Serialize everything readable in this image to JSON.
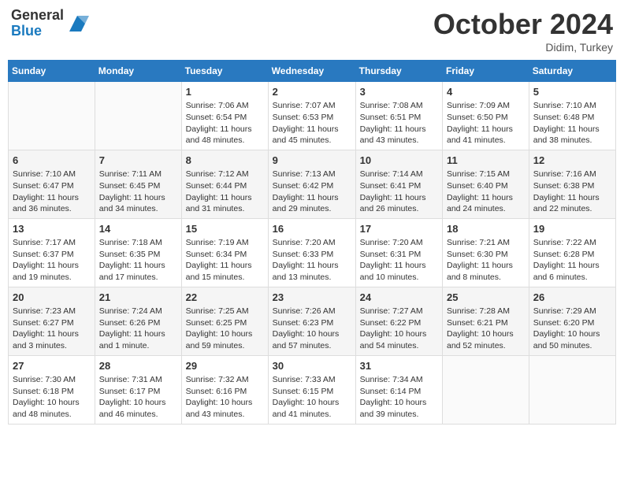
{
  "header": {
    "logo_general": "General",
    "logo_blue": "Blue",
    "month_title": "October 2024",
    "location": "Didim, Turkey"
  },
  "days_of_week": [
    "Sunday",
    "Monday",
    "Tuesday",
    "Wednesday",
    "Thursday",
    "Friday",
    "Saturday"
  ],
  "weeks": [
    [
      {
        "day": "",
        "sunrise": "",
        "sunset": "",
        "daylight": ""
      },
      {
        "day": "",
        "sunrise": "",
        "sunset": "",
        "daylight": ""
      },
      {
        "day": "1",
        "sunrise": "Sunrise: 7:06 AM",
        "sunset": "Sunset: 6:54 PM",
        "daylight": "Daylight: 11 hours and 48 minutes."
      },
      {
        "day": "2",
        "sunrise": "Sunrise: 7:07 AM",
        "sunset": "Sunset: 6:53 PM",
        "daylight": "Daylight: 11 hours and 45 minutes."
      },
      {
        "day": "3",
        "sunrise": "Sunrise: 7:08 AM",
        "sunset": "Sunset: 6:51 PM",
        "daylight": "Daylight: 11 hours and 43 minutes."
      },
      {
        "day": "4",
        "sunrise": "Sunrise: 7:09 AM",
        "sunset": "Sunset: 6:50 PM",
        "daylight": "Daylight: 11 hours and 41 minutes."
      },
      {
        "day": "5",
        "sunrise": "Sunrise: 7:10 AM",
        "sunset": "Sunset: 6:48 PM",
        "daylight": "Daylight: 11 hours and 38 minutes."
      }
    ],
    [
      {
        "day": "6",
        "sunrise": "Sunrise: 7:10 AM",
        "sunset": "Sunset: 6:47 PM",
        "daylight": "Daylight: 11 hours and 36 minutes."
      },
      {
        "day": "7",
        "sunrise": "Sunrise: 7:11 AM",
        "sunset": "Sunset: 6:45 PM",
        "daylight": "Daylight: 11 hours and 34 minutes."
      },
      {
        "day": "8",
        "sunrise": "Sunrise: 7:12 AM",
        "sunset": "Sunset: 6:44 PM",
        "daylight": "Daylight: 11 hours and 31 minutes."
      },
      {
        "day": "9",
        "sunrise": "Sunrise: 7:13 AM",
        "sunset": "Sunset: 6:42 PM",
        "daylight": "Daylight: 11 hours and 29 minutes."
      },
      {
        "day": "10",
        "sunrise": "Sunrise: 7:14 AM",
        "sunset": "Sunset: 6:41 PM",
        "daylight": "Daylight: 11 hours and 26 minutes."
      },
      {
        "day": "11",
        "sunrise": "Sunrise: 7:15 AM",
        "sunset": "Sunset: 6:40 PM",
        "daylight": "Daylight: 11 hours and 24 minutes."
      },
      {
        "day": "12",
        "sunrise": "Sunrise: 7:16 AM",
        "sunset": "Sunset: 6:38 PM",
        "daylight": "Daylight: 11 hours and 22 minutes."
      }
    ],
    [
      {
        "day": "13",
        "sunrise": "Sunrise: 7:17 AM",
        "sunset": "Sunset: 6:37 PM",
        "daylight": "Daylight: 11 hours and 19 minutes."
      },
      {
        "day": "14",
        "sunrise": "Sunrise: 7:18 AM",
        "sunset": "Sunset: 6:35 PM",
        "daylight": "Daylight: 11 hours and 17 minutes."
      },
      {
        "day": "15",
        "sunrise": "Sunrise: 7:19 AM",
        "sunset": "Sunset: 6:34 PM",
        "daylight": "Daylight: 11 hours and 15 minutes."
      },
      {
        "day": "16",
        "sunrise": "Sunrise: 7:20 AM",
        "sunset": "Sunset: 6:33 PM",
        "daylight": "Daylight: 11 hours and 13 minutes."
      },
      {
        "day": "17",
        "sunrise": "Sunrise: 7:20 AM",
        "sunset": "Sunset: 6:31 PM",
        "daylight": "Daylight: 11 hours and 10 minutes."
      },
      {
        "day": "18",
        "sunrise": "Sunrise: 7:21 AM",
        "sunset": "Sunset: 6:30 PM",
        "daylight": "Daylight: 11 hours and 8 minutes."
      },
      {
        "day": "19",
        "sunrise": "Sunrise: 7:22 AM",
        "sunset": "Sunset: 6:28 PM",
        "daylight": "Daylight: 11 hours and 6 minutes."
      }
    ],
    [
      {
        "day": "20",
        "sunrise": "Sunrise: 7:23 AM",
        "sunset": "Sunset: 6:27 PM",
        "daylight": "Daylight: 11 hours and 3 minutes."
      },
      {
        "day": "21",
        "sunrise": "Sunrise: 7:24 AM",
        "sunset": "Sunset: 6:26 PM",
        "daylight": "Daylight: 11 hours and 1 minute."
      },
      {
        "day": "22",
        "sunrise": "Sunrise: 7:25 AM",
        "sunset": "Sunset: 6:25 PM",
        "daylight": "Daylight: 10 hours and 59 minutes."
      },
      {
        "day": "23",
        "sunrise": "Sunrise: 7:26 AM",
        "sunset": "Sunset: 6:23 PM",
        "daylight": "Daylight: 10 hours and 57 minutes."
      },
      {
        "day": "24",
        "sunrise": "Sunrise: 7:27 AM",
        "sunset": "Sunset: 6:22 PM",
        "daylight": "Daylight: 10 hours and 54 minutes."
      },
      {
        "day": "25",
        "sunrise": "Sunrise: 7:28 AM",
        "sunset": "Sunset: 6:21 PM",
        "daylight": "Daylight: 10 hours and 52 minutes."
      },
      {
        "day": "26",
        "sunrise": "Sunrise: 7:29 AM",
        "sunset": "Sunset: 6:20 PM",
        "daylight": "Daylight: 10 hours and 50 minutes."
      }
    ],
    [
      {
        "day": "27",
        "sunrise": "Sunrise: 7:30 AM",
        "sunset": "Sunset: 6:18 PM",
        "daylight": "Daylight: 10 hours and 48 minutes."
      },
      {
        "day": "28",
        "sunrise": "Sunrise: 7:31 AM",
        "sunset": "Sunset: 6:17 PM",
        "daylight": "Daylight: 10 hours and 46 minutes."
      },
      {
        "day": "29",
        "sunrise": "Sunrise: 7:32 AM",
        "sunset": "Sunset: 6:16 PM",
        "daylight": "Daylight: 10 hours and 43 minutes."
      },
      {
        "day": "30",
        "sunrise": "Sunrise: 7:33 AM",
        "sunset": "Sunset: 6:15 PM",
        "daylight": "Daylight: 10 hours and 41 minutes."
      },
      {
        "day": "31",
        "sunrise": "Sunrise: 7:34 AM",
        "sunset": "Sunset: 6:14 PM",
        "daylight": "Daylight: 10 hours and 39 minutes."
      },
      {
        "day": "",
        "sunrise": "",
        "sunset": "",
        "daylight": ""
      },
      {
        "day": "",
        "sunrise": "",
        "sunset": "",
        "daylight": ""
      }
    ]
  ]
}
